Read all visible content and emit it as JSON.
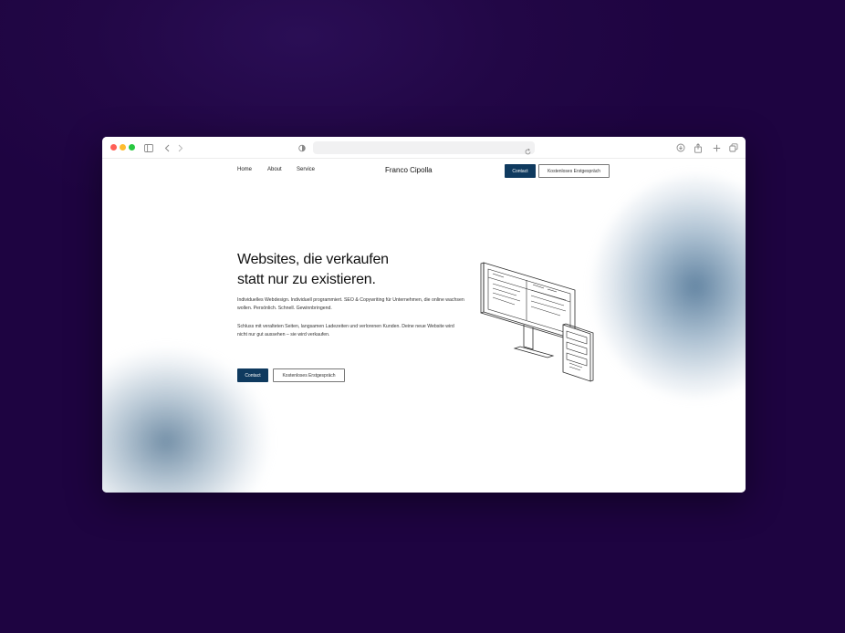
{
  "browser": {
    "url": ""
  },
  "nav": {
    "links": [
      "Home",
      "About",
      "Service"
    ],
    "brand": "Franco Cipolla",
    "contact_label": "Contact",
    "cta_label": "Kostenloses Erstgespräch"
  },
  "hero": {
    "title_line1": "Websites, die verkaufen",
    "title_line2": "statt nur zu existieren.",
    "paragraph1": "Individuelles Webdesign. Individuell programmiert. SEO & Copywriting für Unternehmen, die online wachsen wollen. Persönlich. Schnell. Gewinnbringend.",
    "paragraph2": "Schluss mit veralteten Seiten, langsamen Ladezeiten und verlorenen Kunden. Deine neue Website wird nicht nur gut aussehen – sie wird verkaufen.",
    "contact_label": "Contact",
    "cta_label": "Kostenloses Erstgespräch"
  },
  "colors": {
    "background": "#20053f",
    "accent": "#0f3a5f",
    "text": "#111111"
  },
  "icons": [
    "sidebar-icon",
    "back-icon",
    "forward-icon",
    "privacy-shield-icon",
    "reload-icon",
    "download-icon",
    "share-icon",
    "new-tab-icon",
    "tabs-overview-icon"
  ]
}
